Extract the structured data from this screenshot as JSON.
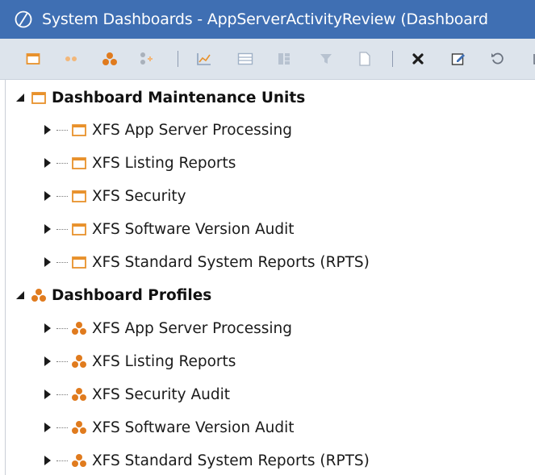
{
  "window": {
    "title": "System Dashboards - AppServerActivityReview (Dashboard"
  },
  "toolbar": {
    "buttons": [
      {
        "icon": "maintenance-unit-icon"
      },
      {
        "icon": "dashboard-group-icon"
      },
      {
        "icon": "profile-icon"
      },
      {
        "icon": "add-profile-icon"
      },
      {
        "icon": "chart-icon"
      },
      {
        "icon": "grid-icon"
      },
      {
        "icon": "components-icon"
      },
      {
        "icon": "filter-icon"
      },
      {
        "icon": "document-icon"
      },
      {
        "icon": "delete-icon"
      },
      {
        "icon": "edit-icon"
      },
      {
        "icon": "refresh-icon"
      }
    ]
  },
  "tree": {
    "groups": [
      {
        "label": "Dashboard Maintenance Units",
        "icon": "maintenance-unit-icon",
        "items": [
          "XFS App Server Processing",
          "XFS Listing Reports",
          "XFS Security",
          "XFS Software Version Audit",
          "XFS Standard System Reports (RPTS)"
        ]
      },
      {
        "label": "Dashboard Profiles",
        "icon": "profile-icon",
        "items": [
          "XFS App Server Processing",
          "XFS Listing Reports",
          "XFS Security Audit",
          "XFS Software Version Audit",
          "XFS Standard System Reports (RPTS)"
        ]
      }
    ]
  },
  "colors": {
    "titlebar": "#3f6fb3",
    "toolbar": "#dde4ec",
    "maintenance_unit_orange": "#e8912b",
    "profile_orange": "#e07b1e"
  }
}
